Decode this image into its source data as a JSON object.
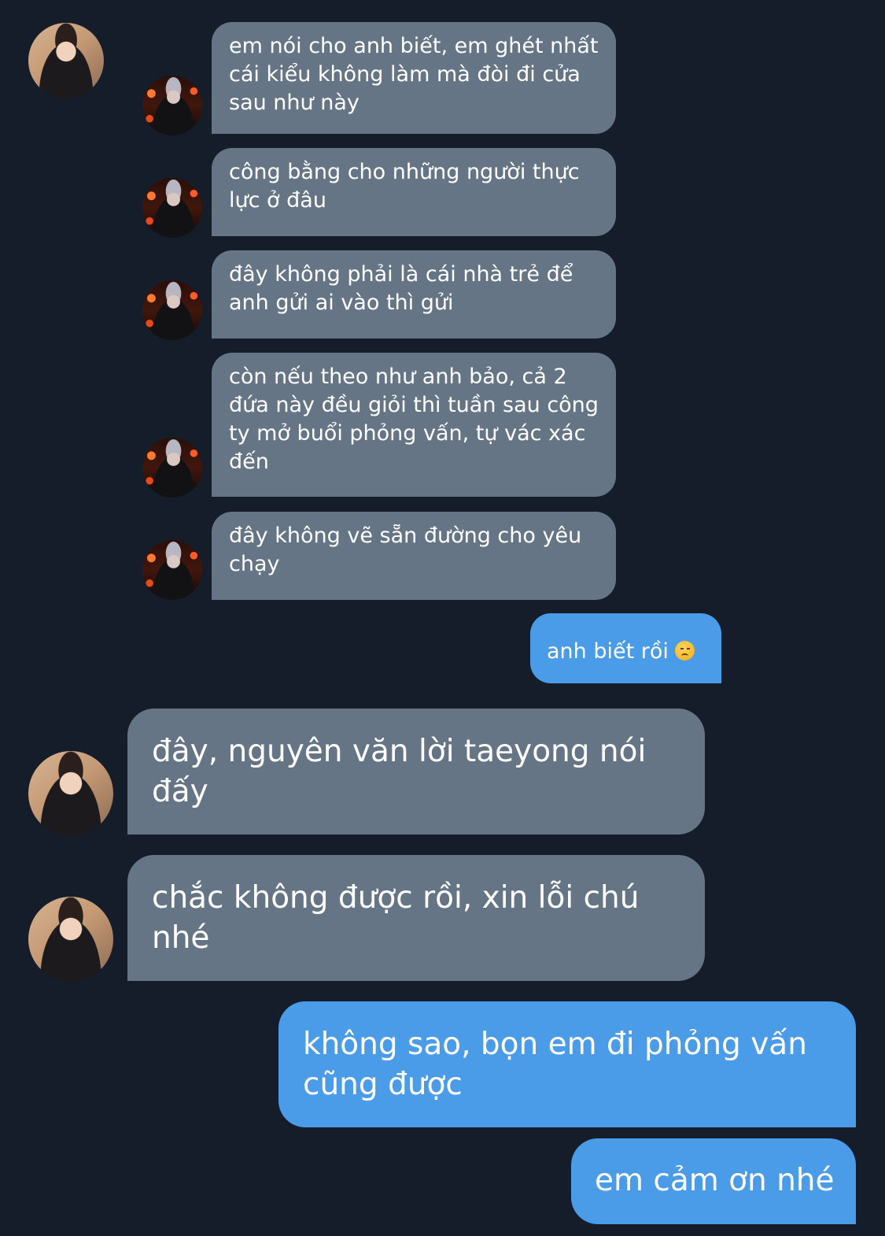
{
  "conversation": {
    "messages": [
      {
        "sender": "other",
        "text": "em nói cho anh biết, em ghét nhất cái kiểu không làm mà đòi đi cửa sau như này"
      },
      {
        "sender": "other",
        "text": "công bằng cho những người thực lực ở đâu"
      },
      {
        "sender": "other",
        "text": "đây không phải là cái nhà trẻ để anh gửi ai vào thì gửi"
      },
      {
        "sender": "other",
        "text": "còn nếu theo như anh bảo, cả 2 đứa này đều giỏi thì tuần sau công ty mở buổi phỏng vấn, tự vác xác đến"
      },
      {
        "sender": "other",
        "text": "đây không vẽ sẵn đường cho yêu chạy"
      },
      {
        "sender": "me",
        "text": "anh biết rồi",
        "emoji": "disappointed-face"
      },
      {
        "sender": "other",
        "text": "đây, nguyên văn lời taeyong nói đấy"
      },
      {
        "sender": "other",
        "text": "chắc không được rồi, xin lỗi chú nhé"
      },
      {
        "sender": "me",
        "text": "không sao, bọn em đi phỏng vấn cũng được"
      },
      {
        "sender": "me",
        "text": "em cảm ơn nhé"
      }
    ]
  },
  "colors": {
    "background": "#151d2b",
    "incoming_bubble": "#667585",
    "outgoing_bubble": "#4a9be8",
    "text": "#ffffff"
  }
}
